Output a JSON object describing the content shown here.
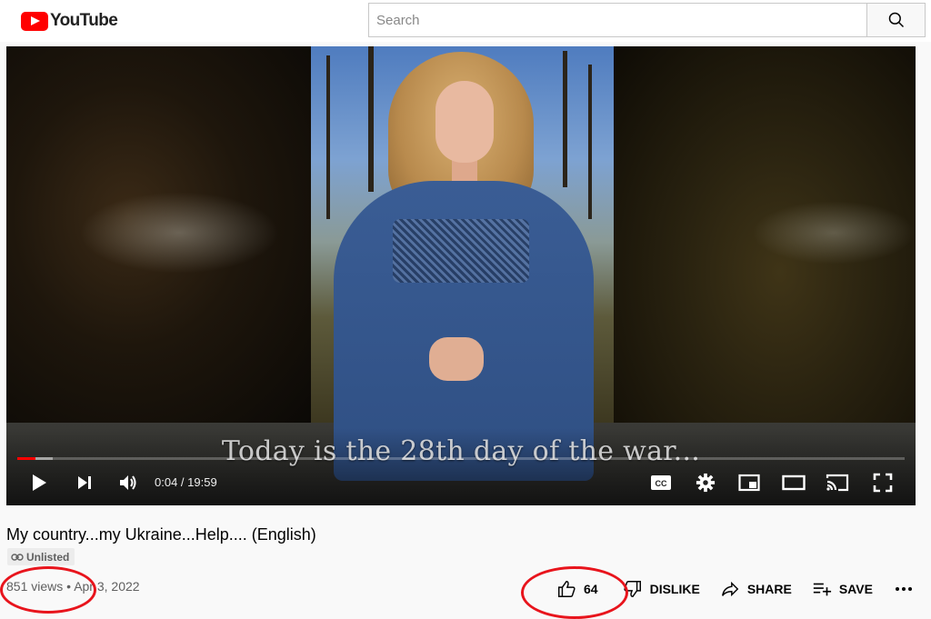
{
  "header": {
    "logo_text": "YouTube",
    "search": {
      "placeholder": "Search",
      "value": ""
    },
    "icons": {
      "logo": "youtube-play-logo",
      "search": "magnifier-icon"
    }
  },
  "player": {
    "caption": "Today is the 28th day of the war...",
    "current_time": "0:04",
    "duration": "19:59",
    "time_display": "0:04 / 19:59",
    "progress_fraction": 0.0033,
    "buffered_fraction": 0.04,
    "controls": [
      "play-icon",
      "next-icon",
      "volume-icon",
      "cc-icon",
      "settings-gear-icon",
      "miniplayer-icon",
      "theater-mode-icon",
      "cast-icon",
      "fullscreen-icon"
    ],
    "cc_label": "CC"
  },
  "video": {
    "title": "My country...my Ukraine...Help.... (English)",
    "privacy_badge": "Unlisted",
    "views": "851 views",
    "separator": "•",
    "date": "Apr 3, 2022",
    "likes": "64",
    "dislike_label": "DISLIKE",
    "share_label": "SHARE",
    "save_label": "SAVE"
  },
  "colors": {
    "brand_red": "#ff0000",
    "annotation_red": "#e8141c",
    "page_bg": "#f9f9f9",
    "meta_text": "#606060"
  },
  "annotations": [
    "circle-around-views",
    "circle-around-likes"
  ]
}
